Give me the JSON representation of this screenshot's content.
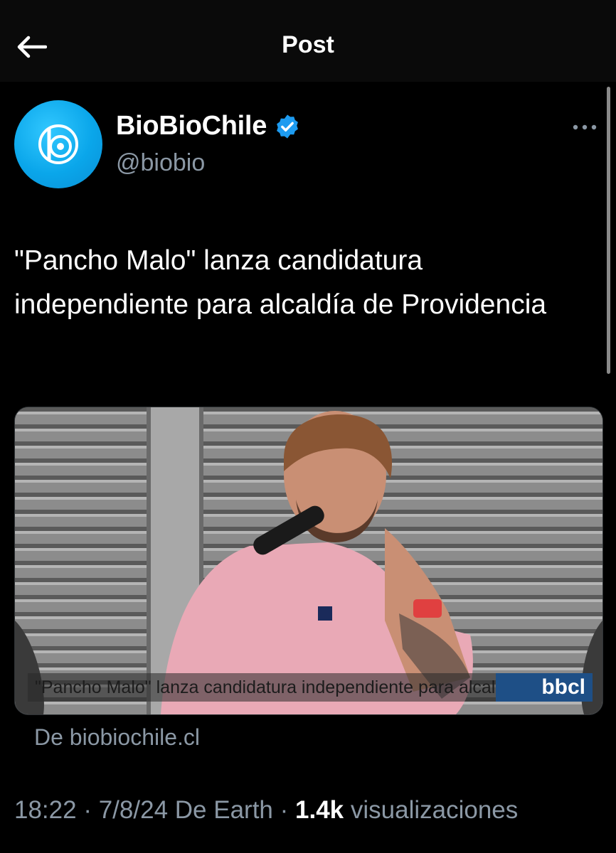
{
  "header": {
    "title": "Post",
    "back_icon": "arrow-left-icon"
  },
  "author": {
    "name": "BioBioChile",
    "handle": "@biobio",
    "verified_icon": "verified-badge-icon",
    "verified_color": "#1d9bf0",
    "avatar_color": "#0aa6ea"
  },
  "post": {
    "text": "\"Pancho Malo\" lanza candidatura independiente para alcaldía de Providencia",
    "media_caption": "\"Pancho Malo\" lanza candidatura independiente para alcal...",
    "media_badge": "bbcl",
    "source_link": "De biobiochile.cl"
  },
  "meta": {
    "time": "18:22",
    "date": "7/8/24",
    "via": "De Earth",
    "views_count": "1.4k",
    "views_label": "visualizaciones"
  }
}
